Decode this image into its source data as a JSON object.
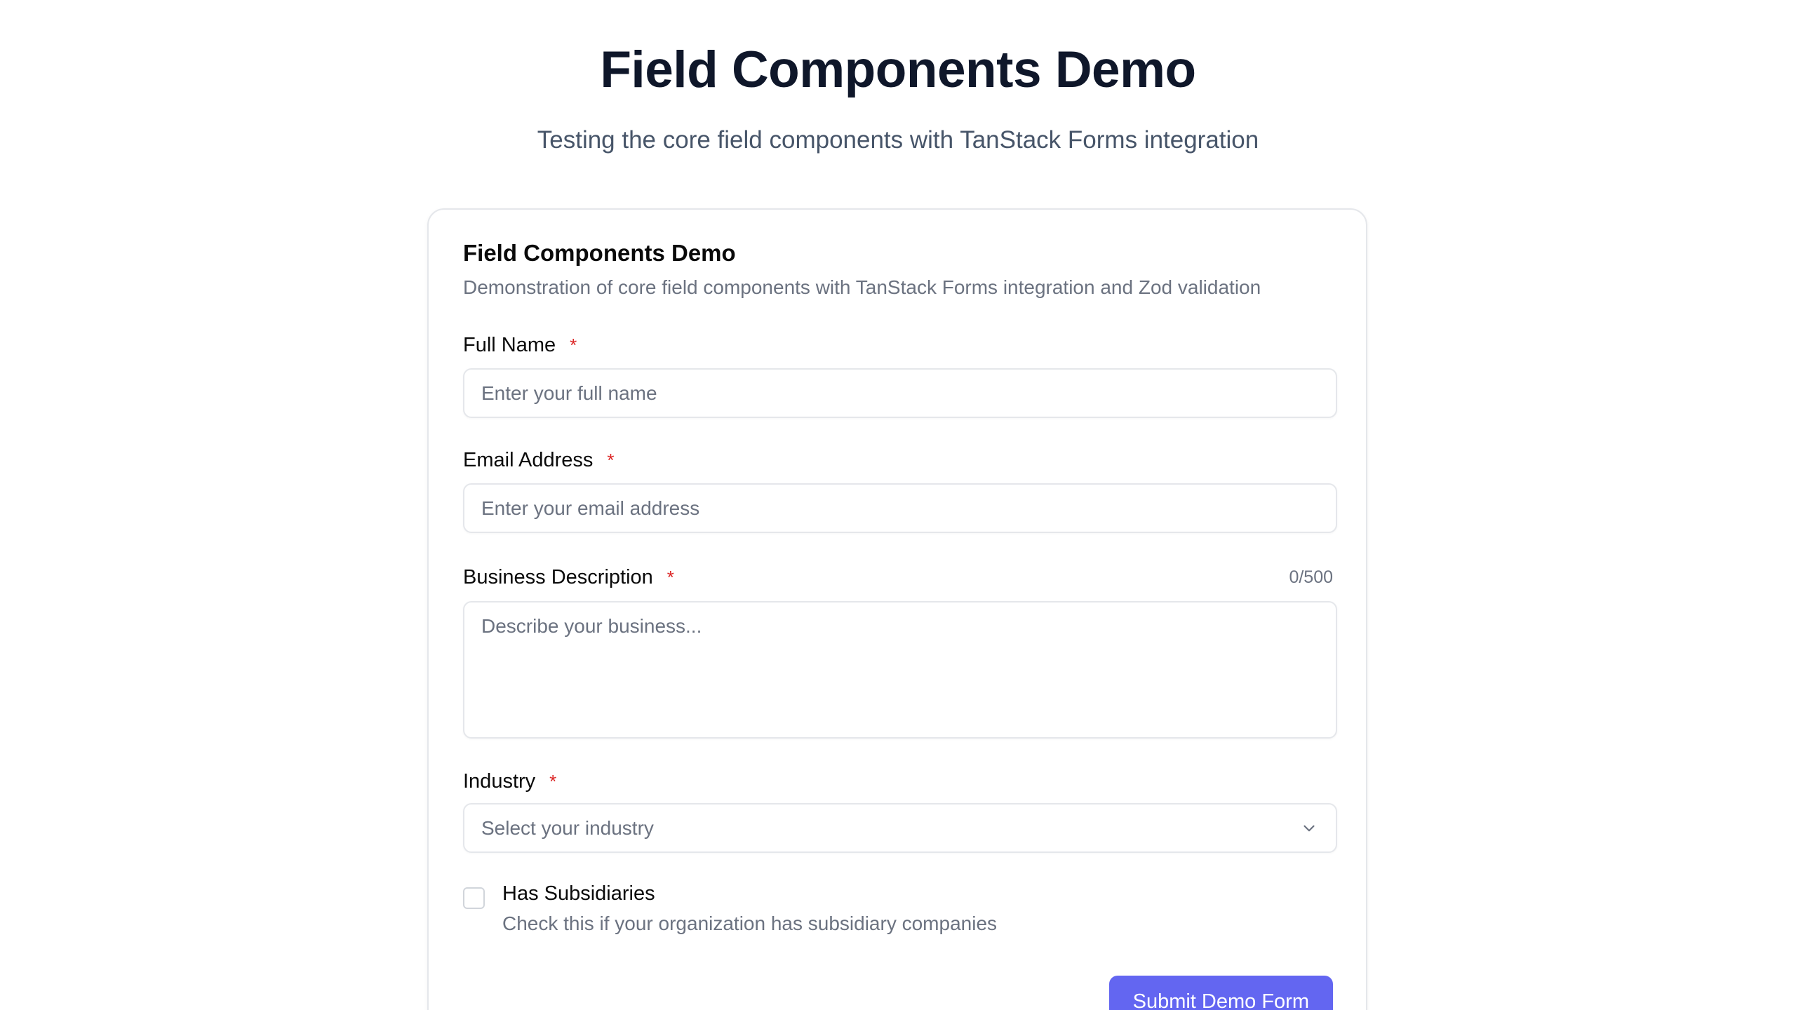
{
  "header": {
    "title": "Field Components Demo",
    "subtitle": "Testing the core field components with TanStack Forms integration"
  },
  "card": {
    "title": "Field Components Demo",
    "description": "Demonstration of core field components with TanStack Forms integration and Zod validation"
  },
  "fields": {
    "full_name": {
      "label": "Full Name",
      "required_mark": "*",
      "placeholder": "Enter your full name",
      "value": ""
    },
    "email": {
      "label": "Email Address",
      "required_mark": "*",
      "placeholder": "Enter your email address",
      "value": ""
    },
    "business_description": {
      "label": "Business Description",
      "required_mark": "*",
      "counter": "0/500",
      "placeholder": "Describe your business...",
      "value": ""
    },
    "industry": {
      "label": "Industry",
      "required_mark": "*",
      "placeholder": "Select your industry",
      "icon": "chevron-down-icon"
    },
    "has_subsidiaries": {
      "label": "Has Subsidiaries",
      "help": "Check this if your organization has subsidiary companies",
      "checked": false
    }
  },
  "actions": {
    "submit_label": "Submit Demo Form"
  },
  "colors": {
    "accent": "#6366f1",
    "required": "#dc2626",
    "border": "#e5e7eb",
    "muted_text": "#6b7280"
  }
}
